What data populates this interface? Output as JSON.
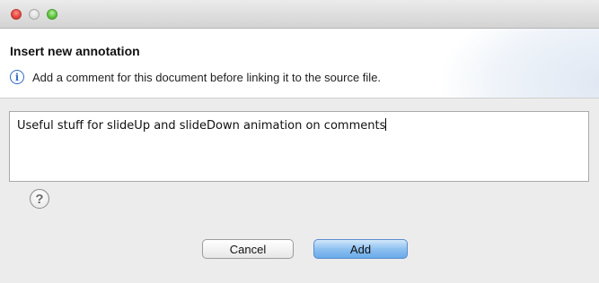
{
  "window": {
    "traffic_lights": [
      "close",
      "minimize",
      "zoom"
    ]
  },
  "header": {
    "title": "Insert new annotation",
    "info_icon": "info-icon",
    "message": "Add a comment for this document before linking it to the source file."
  },
  "comment": {
    "value": "Useful stuff for slideUp and slideDown animation on comments"
  },
  "help": {
    "icon": "help-icon",
    "glyph": "?"
  },
  "buttons": {
    "cancel_label": "Cancel",
    "add_label": "Add"
  },
  "colors": {
    "accent": "#6aaae9",
    "info": "#2f6bc5"
  }
}
